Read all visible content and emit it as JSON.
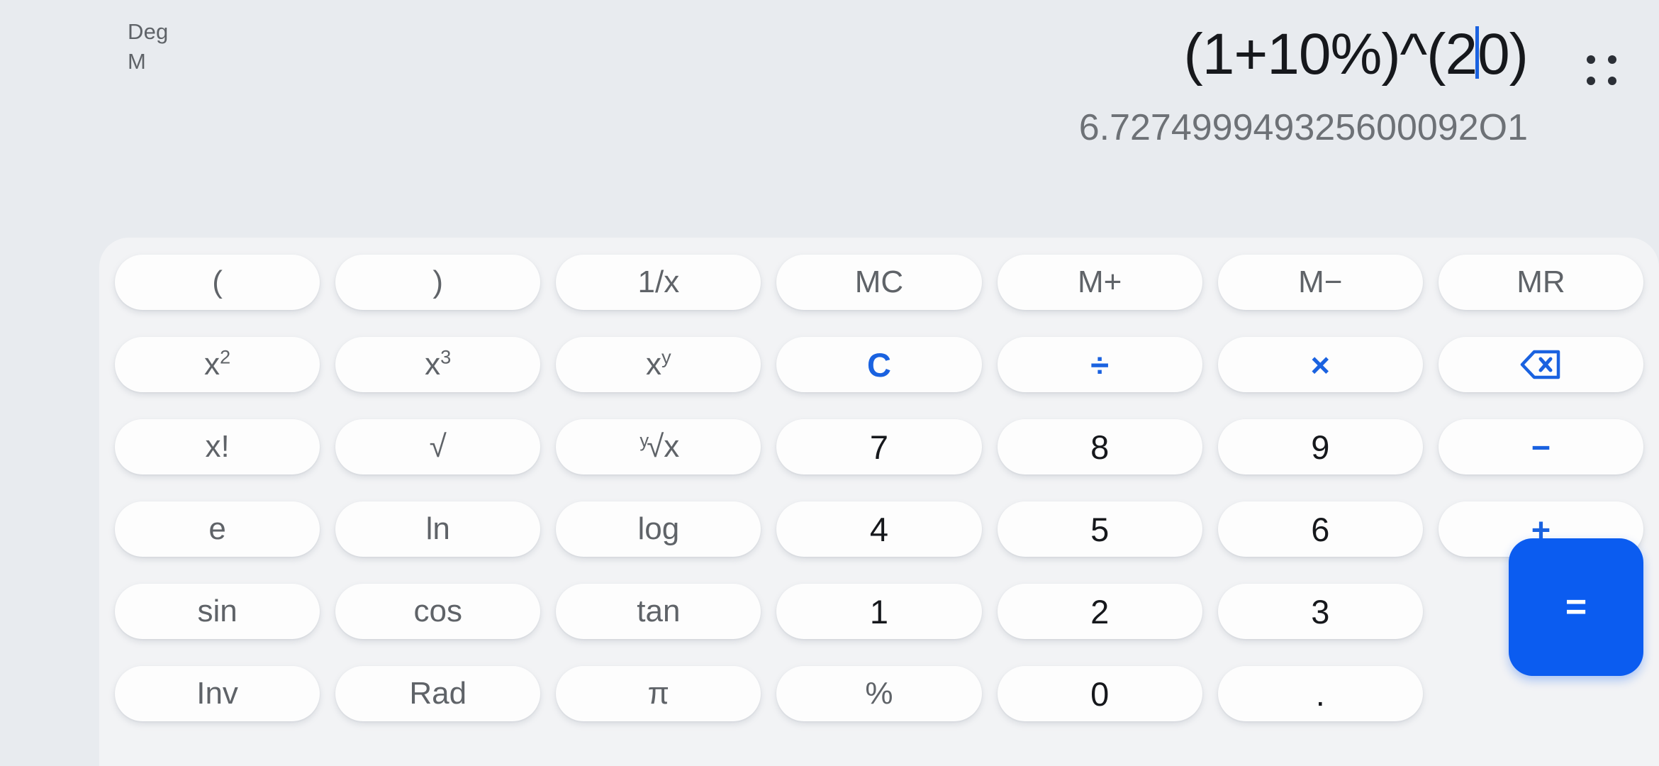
{
  "display": {
    "angle_mode": "Deg",
    "memory_indicator": "M",
    "expression_before_cursor": "(1+10%)^(2",
    "expression_after_cursor": "0)",
    "expression_full": "(1+10%)^(20)",
    "result": "6.727499949325600092O1",
    "menu_icon": "grid-dots-icon",
    "cursor_color": "#1a62e0"
  },
  "colors": {
    "page_background": "#e8ebef",
    "keypad_background": "#f2f3f5",
    "key_background": "#fdfdfd",
    "function_text": "#5f6368",
    "digit_text": "#16181c",
    "operator_blue": "#1a62e0",
    "equals_blue": "#0b5cf0",
    "result_text": "#6d7176"
  },
  "keypad": {
    "rows": [
      [
        {
          "label": "(",
          "name": "open-paren",
          "style": "fn"
        },
        {
          "label": ")",
          "name": "close-paren",
          "style": "fn"
        },
        {
          "label": "1/x",
          "name": "reciprocal",
          "style": "fn"
        },
        {
          "label": "MC",
          "name": "memory-clear",
          "style": "fn"
        },
        {
          "label": "M+",
          "name": "memory-add",
          "style": "fn"
        },
        {
          "label": "M−",
          "name": "memory-subtract",
          "style": "fn"
        },
        {
          "label": "MR",
          "name": "memory-recall",
          "style": "fn"
        }
      ],
      [
        {
          "label": "x²",
          "name": "square",
          "style": "sup",
          "base": "x",
          "sup": "2"
        },
        {
          "label": "x³",
          "name": "cube",
          "style": "sup",
          "base": "x",
          "sup": "3"
        },
        {
          "label": "xʸ",
          "name": "power",
          "style": "sup",
          "base": "x",
          "sup": "y"
        },
        {
          "label": "C",
          "name": "clear",
          "style": "op"
        },
        {
          "label": "÷",
          "name": "divide",
          "style": "op"
        },
        {
          "label": "×",
          "name": "multiply",
          "style": "op"
        },
        {
          "label": "",
          "name": "backspace",
          "style": "icon"
        }
      ],
      [
        {
          "label": "x!",
          "name": "factorial",
          "style": "fn"
        },
        {
          "label": "√",
          "name": "square-root",
          "style": "fn"
        },
        {
          "label": "ʸ√x",
          "name": "nth-root",
          "style": "root",
          "pre": "y",
          "base": "√x"
        },
        {
          "label": "7",
          "name": "digit-7",
          "style": "digit"
        },
        {
          "label": "8",
          "name": "digit-8",
          "style": "digit"
        },
        {
          "label": "9",
          "name": "digit-9",
          "style": "digit"
        },
        {
          "label": "−",
          "name": "subtract",
          "style": "op"
        }
      ],
      [
        {
          "label": "e",
          "name": "eulers-number",
          "style": "fn"
        },
        {
          "label": "ln",
          "name": "natural-log",
          "style": "fn"
        },
        {
          "label": "log",
          "name": "logarithm",
          "style": "fn"
        },
        {
          "label": "4",
          "name": "digit-4",
          "style": "digit"
        },
        {
          "label": "5",
          "name": "digit-5",
          "style": "digit"
        },
        {
          "label": "6",
          "name": "digit-6",
          "style": "digit"
        },
        {
          "label": "+",
          "name": "add",
          "style": "op"
        }
      ],
      [
        {
          "label": "sin",
          "name": "sine",
          "style": "fn"
        },
        {
          "label": "cos",
          "name": "cosine",
          "style": "fn"
        },
        {
          "label": "tan",
          "name": "tangent",
          "style": "fn"
        },
        {
          "label": "1",
          "name": "digit-1",
          "style": "digit"
        },
        {
          "label": "2",
          "name": "digit-2",
          "style": "digit"
        },
        {
          "label": "3",
          "name": "digit-3",
          "style": "digit"
        },
        {
          "label": "",
          "name": "equals-spacer",
          "style": "spacer"
        }
      ],
      [
        {
          "label": "Inv",
          "name": "inverse",
          "style": "fn"
        },
        {
          "label": "Rad",
          "name": "radian-toggle",
          "style": "fn"
        },
        {
          "label": "π",
          "name": "pi",
          "style": "fn"
        },
        {
          "label": "%",
          "name": "percent",
          "style": "fn"
        },
        {
          "label": "0",
          "name": "digit-0",
          "style": "digit"
        },
        {
          "label": ".",
          "name": "decimal-point",
          "style": "digit"
        },
        {
          "label": "",
          "name": "equals-spacer",
          "style": "spacer"
        }
      ]
    ],
    "equals_label": "="
  }
}
